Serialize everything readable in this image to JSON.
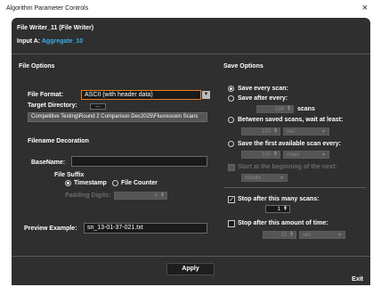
{
  "window": {
    "title": "Algorithm Parameter Controls",
    "close": "×"
  },
  "header": {
    "line1": "File Writer_11 (File Writer)",
    "input_prefix": "Input A: ",
    "input_name": "Aggregate_10"
  },
  "file_options": {
    "title": "File Options",
    "format_label": "File Format:",
    "format_value": "ASCII (with header data)",
    "target_label": "Target Directory:",
    "browse_label": "...",
    "target_value": "Competitive Testing\\Round 2 Comparison Dec2025\\Fluorescein Scans",
    "decoration_title": "Filename Decoration",
    "basename_label": "BaseName:",
    "basename_value": "",
    "suffix_label": "File Suffix",
    "timestamp_label": "Timestamp",
    "counter_label": "File Counter",
    "padding_label": "Padding Digits:",
    "padding_value": "4",
    "preview_label": "Preview Example:",
    "preview_value": "sn_13-01-37-021.txt"
  },
  "save_options": {
    "title": "Save Options",
    "every_scan": "Save every scan:",
    "save_after": "Save after every:",
    "after_value": "100",
    "after_unit": "scans",
    "between_label": "Between saved scans, wait at least:",
    "between_value": "100",
    "between_unit": "sec",
    "first_available": "Save the first available scan every:",
    "first_value": "100",
    "first_unit": "msec",
    "start_beginning": "Start at the beginning of the next:",
    "start_unit": "minute",
    "stop_scans": "Stop after this many scans:",
    "stop_scans_value": "1",
    "stop_time": "Stop after this amount of time:",
    "stop_time_value": "10",
    "stop_time_unit": "sec"
  },
  "buttons": {
    "apply": "Apply",
    "exit": "Exit"
  }
}
